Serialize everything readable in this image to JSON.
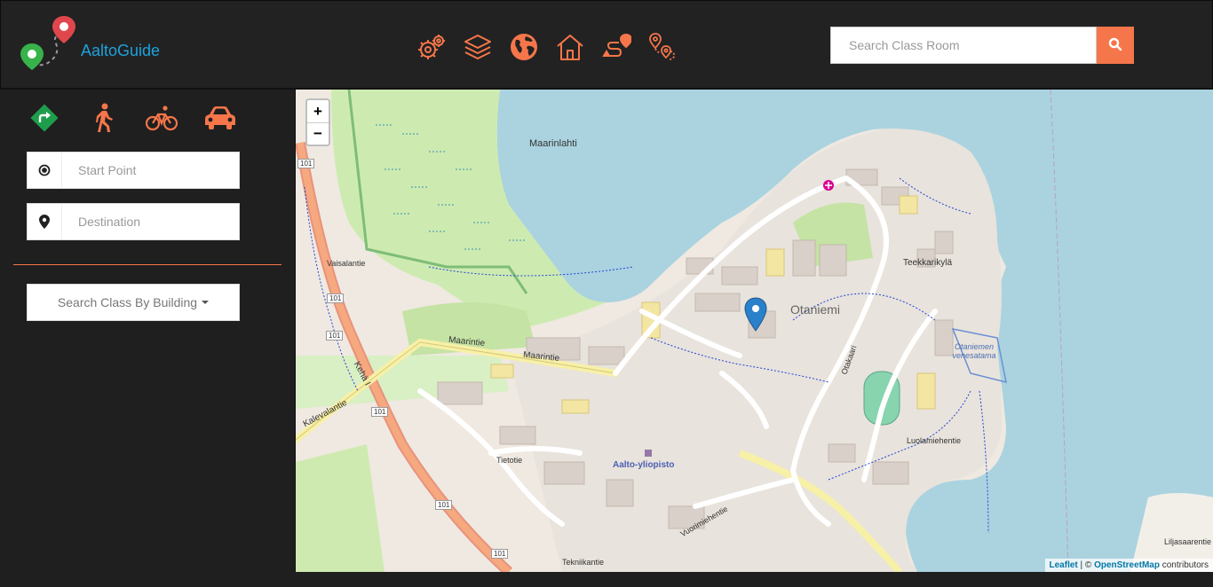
{
  "app": {
    "brand": "AaltoGuide"
  },
  "toolbar": {
    "icons": [
      "gears-icon",
      "layers-icon",
      "globe-icon",
      "home-icon",
      "route-icon",
      "map-pins-icon"
    ],
    "accent": "#f5764a"
  },
  "search": {
    "placeholder": "Search Class Room",
    "button_icon": "search-icon"
  },
  "sidebar": {
    "modes": [
      "directions-icon",
      "walking-icon",
      "bicycle-icon",
      "car-icon"
    ],
    "start_placeholder": "Start Point",
    "destination_placeholder": "Destination",
    "building_dropdown": "Search Class By Building"
  },
  "map": {
    "zoom_in": "+",
    "zoom_out": "−",
    "attribution_leaflet": "Leaflet",
    "attribution_sep": " | © ",
    "attribution_osm": "OpenStreetMap",
    "attribution_tail": " contributors",
    "labels": {
      "maarinlahti": "Maarinlahti",
      "otaniemi": "Otaniemi",
      "teekkarikyla": "Teekkarikylä",
      "maarintie1": "Maarintie",
      "maarintie2": "Maarintie",
      "vaisalantie": "Vaisalantie",
      "kalevalantie": "Kalevalantie",
      "tietotie": "Tietotie",
      "aalto": "Aalto-yliopisto",
      "luolamiehentie": "Luolamiehentie",
      "tekniikantie": "Tekniikantie",
      "otakaari": "Otakaari",
      "vuorimiehentie": "Vuorimiehentie",
      "otaniemen_venesatama": "Otaniemen venesatama",
      "liljasaarentie": "Liljasaarentie",
      "kehä1": "Kehä I",
      "road101a": "101",
      "road101b": "101",
      "road101c": "101",
      "road101d": "101",
      "road101e": "101",
      "road101f": "101"
    }
  }
}
